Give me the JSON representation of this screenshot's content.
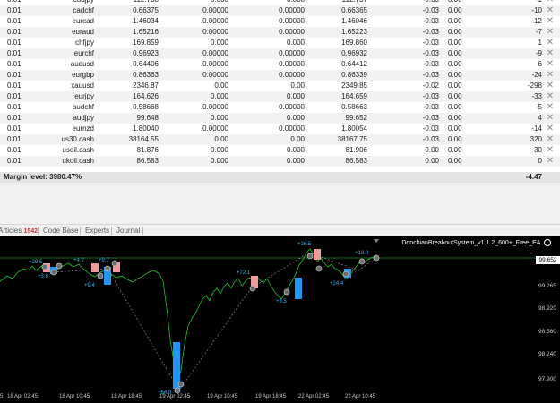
{
  "positions": {
    "rows": [
      {
        "volume": "0.01",
        "symbol": "cadjpy",
        "price": "112.738",
        "sl": "0.000",
        "tp": "0.000",
        "current": "112.737",
        "swap": "-0.03",
        "commission": "0.00",
        "profit": "-1"
      },
      {
        "volume": "0.01",
        "symbol": "cadchf",
        "price": "0.66375",
        "sl": "0.00000",
        "tp": "0.00000",
        "current": "0.66365",
        "swap": "-0.03",
        "commission": "0.00",
        "profit": "-10"
      },
      {
        "volume": "0.01",
        "symbol": "eurcad",
        "price": "1.46034",
        "sl": "0.00000",
        "tp": "0.00000",
        "current": "1.46046",
        "swap": "-0.03",
        "commission": "0.00",
        "profit": "-12"
      },
      {
        "volume": "0.01",
        "symbol": "euraud",
        "price": "1.65216",
        "sl": "0.00000",
        "tp": "0.00000",
        "current": "1.65223",
        "swap": "-0.03",
        "commission": "0.00",
        "profit": "-7"
      },
      {
        "volume": "0.01",
        "symbol": "chfjpy",
        "price": "169.859",
        "sl": "0.000",
        "tp": "0.000",
        "current": "169.860",
        "swap": "-0.03",
        "commission": "0.00",
        "profit": "1"
      },
      {
        "volume": "0.01",
        "symbol": "eurchf",
        "price": "0.96923",
        "sl": "0.00000",
        "tp": "0.00000",
        "current": "0.96932",
        "swap": "-0.03",
        "commission": "0.00",
        "profit": "-9"
      },
      {
        "volume": "0.01",
        "symbol": "audusd",
        "price": "0.64406",
        "sl": "0.00000",
        "tp": "0.00000",
        "current": "0.64412",
        "swap": "-0.03",
        "commission": "0.00",
        "profit": "6"
      },
      {
        "volume": "0.01",
        "symbol": "eurgbp",
        "price": "0.86363",
        "sl": "0.00000",
        "tp": "0.00000",
        "current": "0.86339",
        "swap": "-0.03",
        "commission": "0.00",
        "profit": "-24"
      },
      {
        "volume": "0.01",
        "symbol": "xauusd",
        "price": "2346.87",
        "sl": "0.00",
        "tp": "0.00",
        "current": "2349.85",
        "swap": "-0.02",
        "commission": "0.00",
        "profit": "-298"
      },
      {
        "volume": "0.01",
        "symbol": "eurjpy",
        "price": "164.626",
        "sl": "0.000",
        "tp": "0.000",
        "current": "164.659",
        "swap": "-0.03",
        "commission": "0.00",
        "profit": "-33"
      },
      {
        "volume": "0.01",
        "symbol": "audchf",
        "price": "0.58668",
        "sl": "0.00000",
        "tp": "0.00000",
        "current": "0.58663",
        "swap": "-0.03",
        "commission": "0.00",
        "profit": "-5"
      },
      {
        "volume": "0.01",
        "symbol": "audjpy",
        "price": "99.648",
        "sl": "0.000",
        "tp": "0.000",
        "current": "99.652",
        "swap": "-0.03",
        "commission": "0.00",
        "profit": "4"
      },
      {
        "volume": "0.01",
        "symbol": "eurnzd",
        "price": "1.80040",
        "sl": "0.00000",
        "tp": "0.00000",
        "current": "1.80054",
        "swap": "-0.03",
        "commission": "0.00",
        "profit": "-14"
      },
      {
        "volume": "0.01",
        "symbol": "us30.cash",
        "price": "38164.55",
        "sl": "0.00",
        "tp": "0.00",
        "current": "38167.75",
        "swap": "-0.03",
        "commission": "0.00",
        "profit": "320"
      },
      {
        "volume": "0.01",
        "symbol": "usoil.cash",
        "price": "81.876",
        "sl": "0.000",
        "tp": "0.000",
        "current": "81.906",
        "swap": "0.00",
        "commission": "0.00",
        "profit": "-30"
      },
      {
        "volume": "0.01",
        "symbol": "ukoil.cash",
        "price": "86.583",
        "sl": "0.000",
        "tp": "0.000",
        "current": "86.583",
        "swap": "0.00",
        "commission": "0.00",
        "profit": "0"
      }
    ],
    "margin_label": "Margin level: 3980.47%",
    "total_profit": "-4.47"
  },
  "tabs": [
    {
      "label": "Articles",
      "badge": "1542"
    },
    {
      "label": "Code Base"
    },
    {
      "label": "Experts"
    },
    {
      "label": "Journal"
    }
  ],
  "chart": {
    "ea_name": "DonchianBreakoutSystem_v1.1.2_600+_Free_EA",
    "current_price": "99.652",
    "price_ticks": [
      "99.265",
      "98.920",
      "98.580",
      "98.240",
      "97.900"
    ],
    "time_ticks": [
      "5",
      "18 Apr 02:45",
      "18 Apr 10:45",
      "18 Apr 18:45",
      "19 Apr 02:45",
      "19 Apr 10:45",
      "19 Apr 18:45",
      "22 Apr 02:45",
      "22 Apr 10:45"
    ],
    "trade_labels": [
      "+29.5",
      "+3.8",
      "+4.2",
      "+9.4",
      "+9.7",
      "+72.1",
      "+8.5",
      "+26.5",
      "+24.4",
      "+18.0",
      "+64.0"
    ],
    "colors": {
      "line": "#22c42a",
      "bull": "#2196f3",
      "bear": "#ef9a9a",
      "background": "#000000"
    }
  }
}
